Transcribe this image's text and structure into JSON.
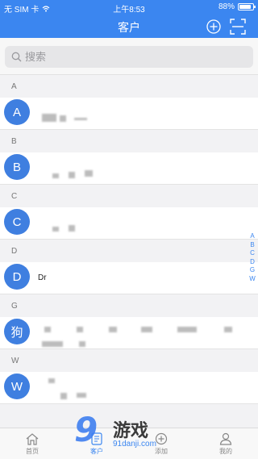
{
  "status_bar": {
    "carrier": "无 SIM 卡",
    "time": "上午8:53",
    "battery": "88%",
    "battery_level": 0.88
  },
  "header": {
    "title": "客户"
  },
  "search": {
    "placeholder": "搜索"
  },
  "sections": [
    {
      "letter": "A",
      "avatar": "A",
      "name": ""
    },
    {
      "letter": "B",
      "avatar": "B",
      "name": ""
    },
    {
      "letter": "C",
      "avatar": "C",
      "name": ""
    },
    {
      "letter": "D",
      "avatar": "D",
      "name": "Dr"
    },
    {
      "letter": "G",
      "avatar": "狗",
      "name": ""
    },
    {
      "letter": "W",
      "avatar": "W",
      "name": ""
    }
  ],
  "index_letters": [
    "A",
    "B",
    "C",
    "D",
    "G",
    "W"
  ],
  "tabs": [
    {
      "label": "首页",
      "icon": "home-icon"
    },
    {
      "label": "客户",
      "icon": "clients-icon"
    },
    {
      "label": "添加",
      "icon": "add-icon"
    },
    {
      "label": "我的",
      "icon": "profile-icon"
    }
  ],
  "watermark": {
    "text": "游戏",
    "url": "91danji.com"
  },
  "colors": {
    "accent": "#3b86f0",
    "avatar": "#3f7fe0"
  }
}
